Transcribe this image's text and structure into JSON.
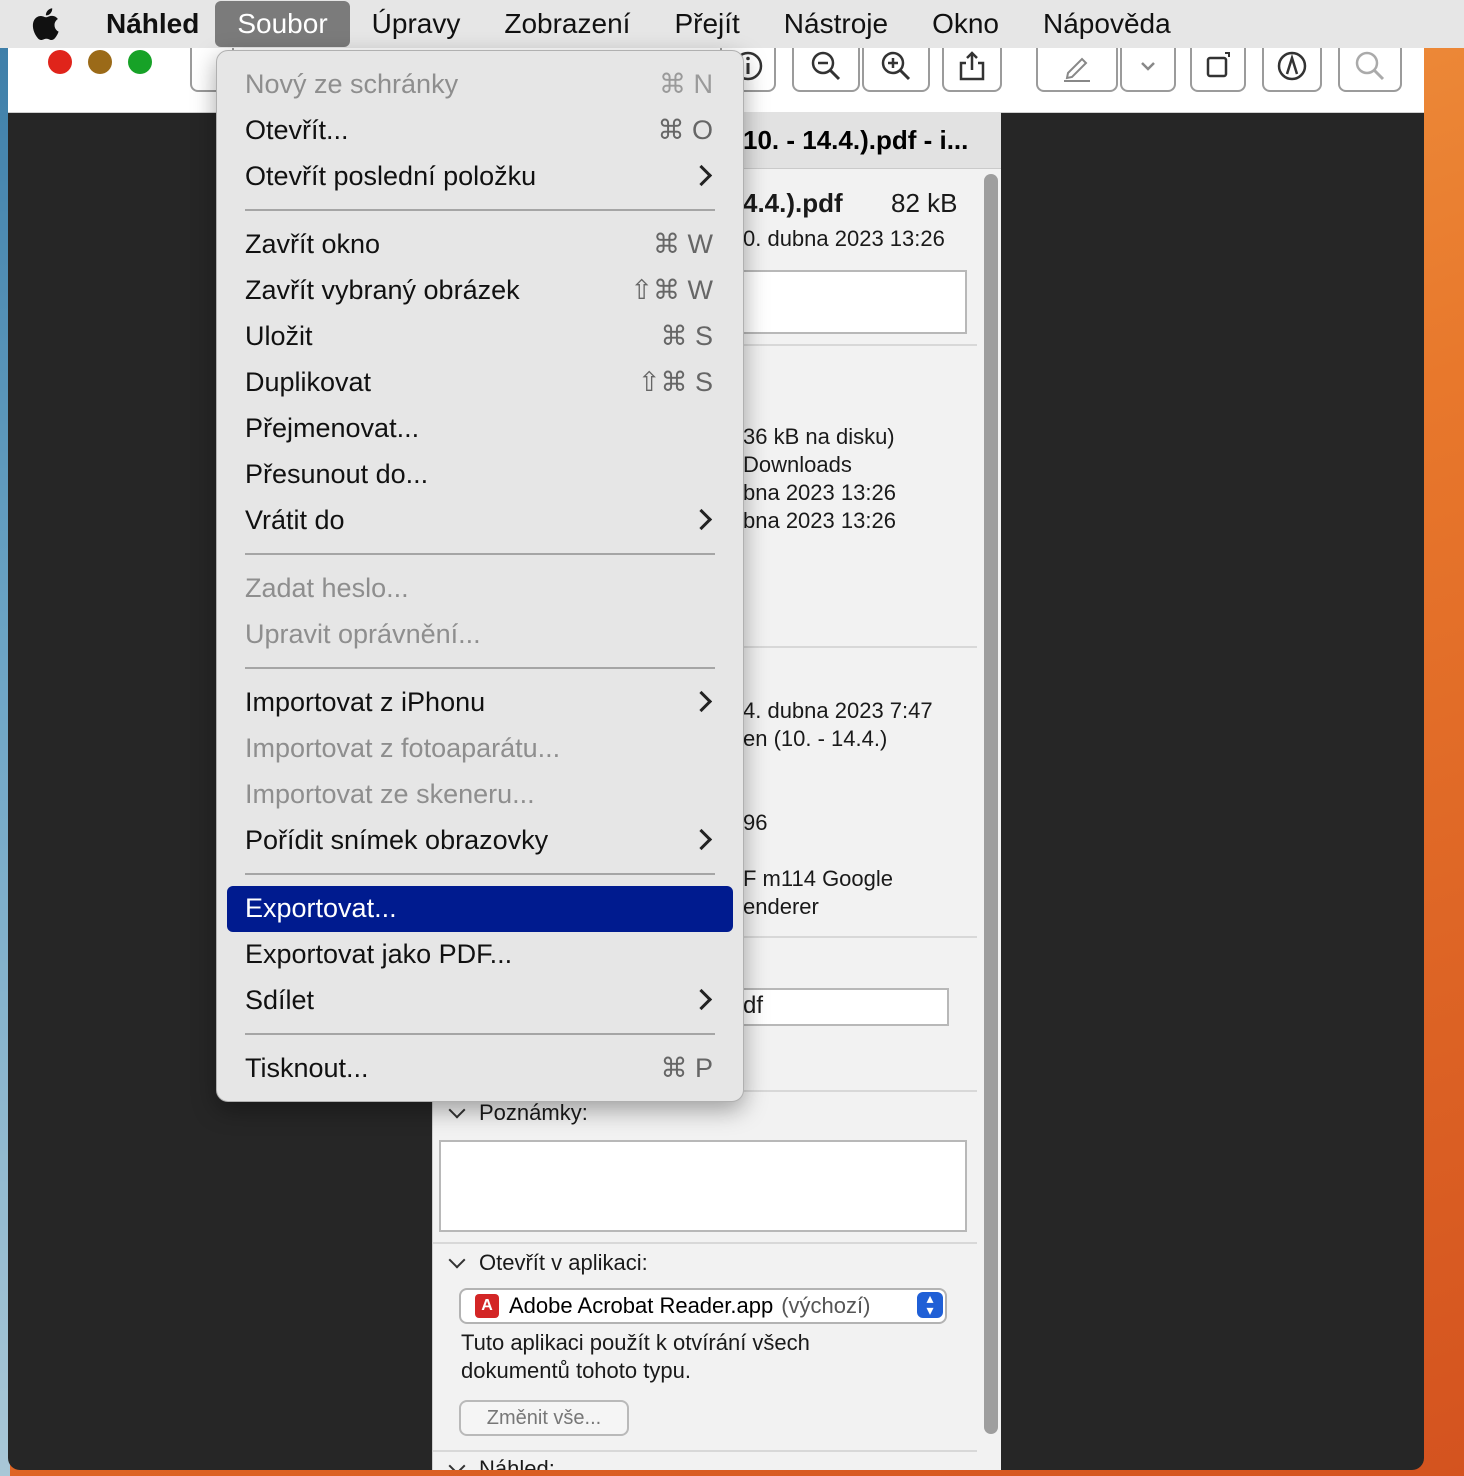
{
  "menubar": {
    "app_name": "Náhled",
    "items": [
      "Soubor",
      "Úpravy",
      "Zobrazení",
      "Přejít",
      "Nástroje",
      "Okno",
      "Nápověda"
    ]
  },
  "window": {
    "traffic_lights": {
      "close": "#e0241b",
      "minimize": "#9b6a18",
      "zoom": "#17a227"
    }
  },
  "inspector": {
    "title": "10. - 14.4.).pdf - i...",
    "file_name": "4.4.).pdf",
    "file_size": "82 kB",
    "date": "0. dubna 2023 13:26",
    "info_lines": [
      "36 kB na disku)",
      "Downloads",
      "bna 2023 13:26",
      "bna 2023 13:26"
    ],
    "more_lines": [
      "4. dubna 2023 7:47",
      "en (10. - 14.4.)",
      "96",
      "F m114 Google",
      "enderer"
    ],
    "name_field": "df",
    "notes_label": "Poznámky:",
    "open_with_label": "Otevřít v aplikaci:",
    "app_name": "Adobe Acrobat Reader.app",
    "app_default": "(výchozí)",
    "open_with_desc_1": "Tuto aplikaci použít k otvírání všech",
    "open_with_desc_2": "dokumentů tohoto typu.",
    "change_all": "Změnit vše...",
    "preview_label": "Náhled:"
  },
  "file_menu": {
    "items": [
      {
        "label": "Nový ze schránky",
        "shortcut": "⌘ N",
        "disabled": true
      },
      {
        "label": "Otevřít...",
        "shortcut": "⌘ O"
      },
      {
        "label": "Otevřít poslední položku",
        "submenu": true
      },
      {
        "label": "Zavřít okno",
        "shortcut": "⌘ W"
      },
      {
        "label": "Zavřít vybraný obrázek",
        "shortcut": "⇧⌘ W"
      },
      {
        "label": "Uložit",
        "shortcut": "⌘ S"
      },
      {
        "label": "Duplikovat",
        "shortcut": "⇧⌘ S"
      },
      {
        "label": "Přejmenovat..."
      },
      {
        "label": "Přesunout do..."
      },
      {
        "label": "Vrátit do",
        "submenu": true
      },
      {
        "label": "Zadat heslo...",
        "disabled": true
      },
      {
        "label": "Upravit oprávnění...",
        "disabled": true
      },
      {
        "label": "Importovat z iPhonu",
        "submenu": true
      },
      {
        "label": "Importovat z fotoaparátu...",
        "disabled": true
      },
      {
        "label": "Importovat ze skeneru...",
        "disabled": true
      },
      {
        "label": "Pořídit snímek obrazovky",
        "submenu": true
      },
      {
        "label": "Exportovat...",
        "selected": true
      },
      {
        "label": "Exportovat jako PDF..."
      },
      {
        "label": "Sdílet",
        "submenu": true
      },
      {
        "label": "Tisknout...",
        "shortcut": "⌘ P"
      }
    ]
  },
  "colors": {
    "selection": "#001b8f",
    "menubar": "#e6e6e6"
  }
}
